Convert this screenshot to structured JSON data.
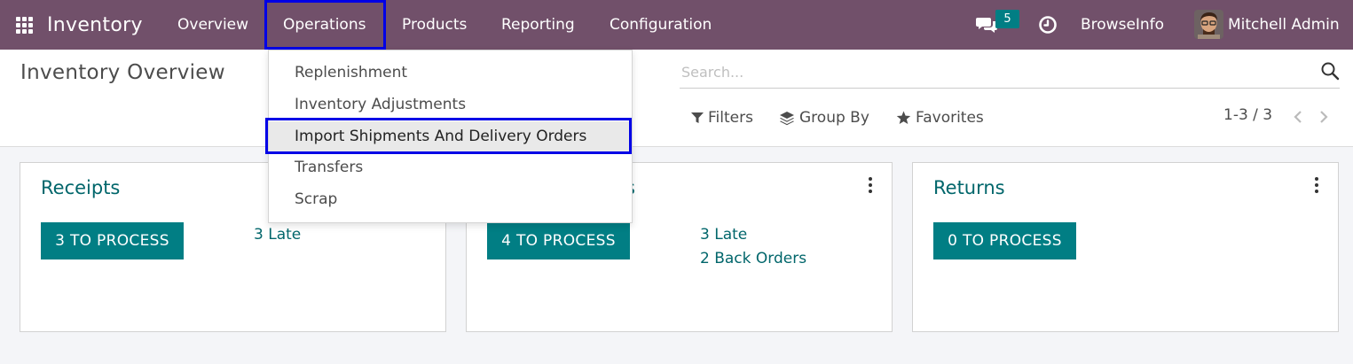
{
  "navbar": {
    "brand": "Inventory",
    "menus": [
      "Overview",
      "Operations",
      "Products",
      "Reporting",
      "Configuration"
    ],
    "chat_count": "5",
    "company": "BrowseInfo",
    "user": "Mitchell Admin",
    "bg_color": "#71506a"
  },
  "control_panel": {
    "title": "Inventory Overview",
    "search_placeholder": "Search...",
    "filters_label": "Filters",
    "group_by_label": "Group By",
    "favorites_label": "Favorites",
    "pager": "1-3 / 3"
  },
  "operations_menu": {
    "items": [
      "Replenishment",
      "Inventory Adjustments",
      "Import Shipments And Delivery Orders",
      "Transfers",
      "Scrap"
    ],
    "selected": "Import Shipments And Delivery Orders"
  },
  "cards": [
    {
      "title": "Receipts",
      "button": "3 TO PROCESS",
      "stats": [
        "3 Late"
      ]
    },
    {
      "title": "Delivery Orders",
      "visible_title_fragment": "s",
      "button": "4 TO PROCESS",
      "stats": [
        "3 Late",
        "2 Back Orders"
      ]
    },
    {
      "title": "Returns",
      "button": "0 TO PROCESS",
      "stats": []
    }
  ],
  "colors": {
    "accent": "#017e84",
    "link": "#01666b",
    "highlight_border": "#0000e6"
  }
}
